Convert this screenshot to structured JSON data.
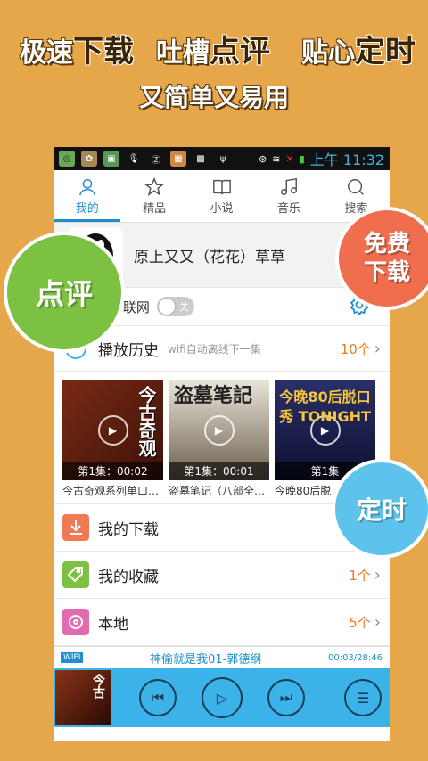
{
  "promo": {
    "line1_a": "极速",
    "line1_b": "下载",
    "line1_c": "吐槽",
    "line1_d": "点评",
    "line1_e": "贴心",
    "line1_f": "定时",
    "line2": "又简单又易用"
  },
  "status": {
    "time": "上午 11:32"
  },
  "tabs": [
    {
      "label": "我的",
      "icon": "user-icon"
    },
    {
      "label": "精品",
      "icon": "star-icon"
    },
    {
      "label": "小说",
      "icon": "book-icon"
    },
    {
      "label": "音乐",
      "icon": "music-icon"
    },
    {
      "label": "搜索",
      "icon": "search-icon"
    }
  ],
  "profile": {
    "name": "原上又又（花花）草草"
  },
  "wifi": {
    "label": "wifi联网",
    "toggle": "关"
  },
  "history": {
    "label": "播放历史",
    "sub": "wifi自动离线下一集",
    "count": "10个"
  },
  "gallery": [
    {
      "episode": "第1集：00:02",
      "caption": "今古奇观系列单口…",
      "cover_text": "今古奇观"
    },
    {
      "episode": "第1集：00:01",
      "caption": "盗墓笔记（八部全…",
      "cover_text": "盗墓笔記"
    },
    {
      "episode": "第1集",
      "caption": "今晚80后脱",
      "cover_text": "今晚80后脱口秀 TONIGHT"
    }
  ],
  "rows": {
    "download": {
      "label": "我的下载"
    },
    "favorites": {
      "label": "我的收藏",
      "count": "1个"
    },
    "local": {
      "label": "本地",
      "count": "5个"
    }
  },
  "nowplaying": {
    "tag": "WIFI",
    "title": "神偷就是我01-郭德纲",
    "time": "00:03/28:46"
  },
  "badges": {
    "review": "点评",
    "free1": "免费",
    "free2": "下载",
    "timer": "定时"
  },
  "colors": {
    "background": "#E6A64A",
    "accent": "#1E8FCC",
    "player": "#3BB3E8",
    "count": "#F07A1E",
    "badge_green": "#7DC142",
    "badge_orange": "#F06D4E",
    "badge_blue": "#5EC3EC"
  }
}
